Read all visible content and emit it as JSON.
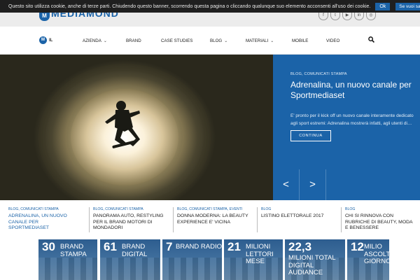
{
  "cookie": {
    "message": "Questo sito utilizza cookie, anche di terze parti. Chiudendo questo banner, scorrendo questa pagina o cliccando qualunque suo elemento acconsenti all'uso dei cookie.",
    "ok_label": "Ok",
    "more_label": "Se vuoi saperne di più clicca qui"
  },
  "header": {
    "logo_text": "MEDIAMOND",
    "logo_mark": "M",
    "socials": [
      {
        "icon": "facebook-icon",
        "glyph": "f"
      },
      {
        "icon": "twitter-icon",
        "glyph": "t"
      },
      {
        "icon": "youtube-icon",
        "glyph": "▶"
      },
      {
        "icon": "linkedin-icon",
        "glyph": "in"
      },
      {
        "icon": "instagram-icon",
        "glyph": "◎"
      }
    ]
  },
  "nav": {
    "logo_mark": "M",
    "logo_text": "IL",
    "items": [
      {
        "label": "Azienda",
        "dropdown": true
      },
      {
        "label": "Brand",
        "dropdown": false
      },
      {
        "label": "Case Studies",
        "dropdown": false
      },
      {
        "label": "Blog",
        "dropdown": true
      },
      {
        "label": "Materiali",
        "dropdown": true
      },
      {
        "label": "Mobile",
        "dropdown": false
      },
      {
        "label": "Video",
        "dropdown": false
      }
    ],
    "search_icon": "search-icon"
  },
  "hero": {
    "category": "BLOG, COMUNICATI STAMPA",
    "title": "Adrenalina, un nuovo canale per Sportmediaset",
    "excerpt": "E' pronto per il kick off un nuovo canale interamente dedicato agli sport estremi: Adrenalina mostrerà infatti, agli utenti di…",
    "cta_label": "Continua",
    "prev_arrow": "<",
    "next_arrow": ">",
    "accent_color": "#1b63a8"
  },
  "news": [
    {
      "category": "BLOG, COMUNICATI STAMPA",
      "title": "Adrenalina, un nuovo canale per Sportmediaset",
      "active": true
    },
    {
      "category": "BLOG, COMUNICATI STAMPA",
      "title": "Panorama Auto, restyling per il brand Motori di Mondadori",
      "active": false
    },
    {
      "category": "BLOG, COMUNICATI STAMPA, EVENTI",
      "title": "Donna Moderna: la beauty experience e' vicina",
      "active": false
    },
    {
      "category": "BLOG",
      "title": "Listino elettorale 2017",
      "active": false
    },
    {
      "category": "BLOG",
      "title": "Chi si rinnova con rubriche di beauty, moda e benessere",
      "active": false
    }
  ],
  "stats": [
    {
      "number": "30",
      "label": "BRAND STAMPA"
    },
    {
      "number": "61",
      "label": "BRAND DIGITAL"
    },
    {
      "number": "7",
      "label": "BRAND RADIO"
    },
    {
      "number": "21",
      "label": "MILIONI LETTORI MESE"
    },
    {
      "number": "22,3",
      "label": "MILIONI TOTAL DIGITAL AUDIANCE"
    },
    {
      "number": "12",
      "label": "MILIO ASCOLTATO GIORNO M"
    }
  ]
}
